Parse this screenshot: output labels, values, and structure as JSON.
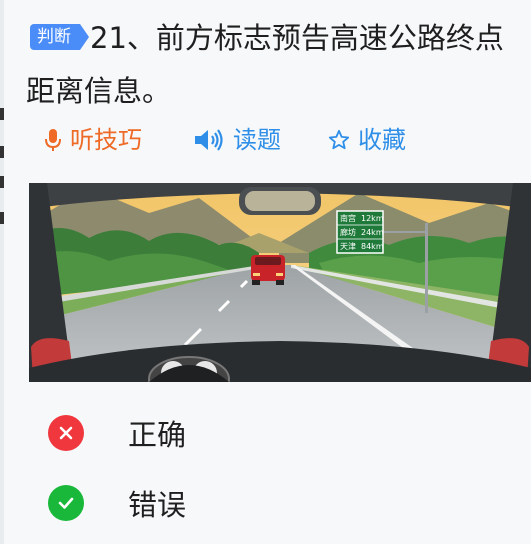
{
  "question": {
    "type_badge": "判断",
    "text": "21、前方标志预告高速公路终点距离信息。"
  },
  "actions": {
    "tips": "听技巧",
    "read": "读题",
    "favorite": "收藏"
  },
  "scene": {
    "sign_rows": [
      {
        "place": "南宫",
        "km": "12km"
      },
      {
        "place": "廊坊",
        "km": "24km"
      },
      {
        "place": "天津",
        "km": "84km"
      }
    ]
  },
  "options": [
    {
      "label": "正确",
      "icon": "wrong-x-icon",
      "color": "#f0373d"
    },
    {
      "label": "错误",
      "icon": "check-icon",
      "color": "#19b83a"
    }
  ],
  "colors": {
    "badge": "#4b8df8",
    "tips": "#ee6a26",
    "read": "#2f8fe8"
  }
}
